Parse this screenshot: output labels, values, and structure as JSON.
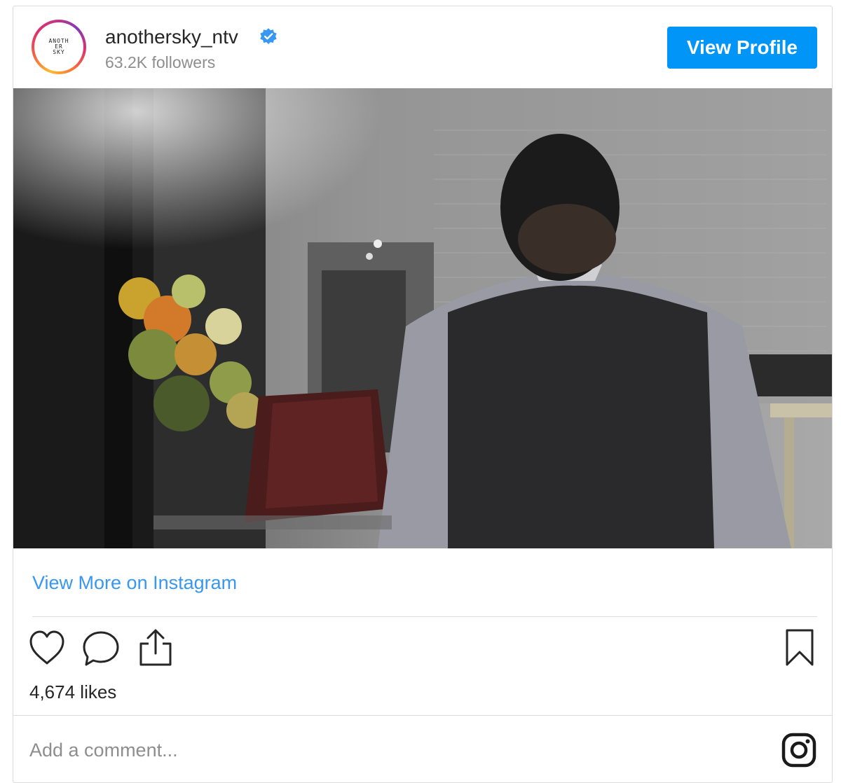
{
  "header": {
    "avatar_text": "ANOTH\nER\nSKY",
    "username": "anothersky_ntv",
    "followers": "63.2K followers",
    "view_profile_label": "View Profile"
  },
  "media": {
    "description_icon": "video-thumbnail"
  },
  "links": {
    "view_more": "View More on Instagram"
  },
  "actions": {
    "icons": [
      "heart-icon",
      "comment-icon",
      "share-icon",
      "bookmark-icon"
    ]
  },
  "likes": "4,674 likes",
  "comment": {
    "placeholder": "Add a comment..."
  },
  "colors": {
    "accent": "#0095f6",
    "link": "#3897f0",
    "text": "#262626",
    "muted": "#8e8e8e",
    "border": "#dbdbdb"
  }
}
